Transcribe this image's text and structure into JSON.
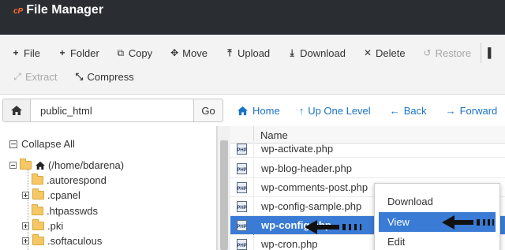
{
  "app": {
    "logo": "cP",
    "title": "File Manager"
  },
  "toolbar": {
    "row1": [
      {
        "label": "File",
        "icon": "plus-icon",
        "glyph": "+",
        "disabled": false
      },
      {
        "label": "Folder",
        "icon": "plus-icon",
        "glyph": "+",
        "disabled": false
      },
      {
        "label": "Copy",
        "icon": "copy-icon",
        "glyph": "⧉",
        "disabled": false
      },
      {
        "label": "Move",
        "icon": "move-icon",
        "glyph": "✥",
        "disabled": false
      },
      {
        "label": "Upload",
        "icon": "upload-icon",
        "glyph": "⤒",
        "disabled": false
      },
      {
        "label": "Download",
        "icon": "download-icon",
        "glyph": "⤓",
        "disabled": false
      },
      {
        "label": "Delete",
        "icon": "close-icon",
        "glyph": "✕",
        "disabled": false
      },
      {
        "label": "Restore",
        "icon": "undo-icon",
        "glyph": "↺",
        "disabled": true
      }
    ],
    "row2": [
      {
        "label": "Extract",
        "icon": "extract-icon",
        "glyph": "⤢",
        "disabled": true
      },
      {
        "label": "Compress",
        "icon": "compress-icon",
        "glyph": "⤡",
        "disabled": false
      }
    ]
  },
  "pathbar": {
    "value": "public_html",
    "go_label": "Go"
  },
  "nav": [
    {
      "label": "Home",
      "icon": "home-icon",
      "glyph": "⌂"
    },
    {
      "label": "Up One Level",
      "icon": "level-up-icon",
      "glyph": "↑"
    },
    {
      "label": "Back",
      "icon": "arrow-left-icon",
      "glyph": "←"
    },
    {
      "label": "Forward",
      "icon": "arrow-right-icon",
      "glyph": "→"
    }
  ],
  "tree": {
    "collapse_label": "Collapse All",
    "root_label": "(/home/bdarena)",
    "items": [
      {
        "label": ".autorespond",
        "expandable": false
      },
      {
        "label": ".cpanel",
        "expandable": true
      },
      {
        "label": ".htpasswds",
        "expandable": false
      },
      {
        "label": ".pki",
        "expandable": true
      },
      {
        "label": ".softaculous",
        "expandable": true
      }
    ]
  },
  "filelist": {
    "column_name": "Name",
    "file_icon_text": "PHP",
    "files": [
      {
        "name": "wp-activate.php",
        "selected": false
      },
      {
        "name": "wp-blog-header.php",
        "selected": false
      },
      {
        "name": "wp-comments-post.php",
        "selected": false
      },
      {
        "name": "wp-config-sample.php",
        "selected": false
      },
      {
        "name": "wp-config.php",
        "selected": true
      },
      {
        "name": "wp-cron.php",
        "selected": false
      }
    ]
  },
  "context_menu": {
    "items": [
      {
        "label": "Download",
        "active": false
      },
      {
        "label": "View",
        "active": true
      },
      {
        "label": "Edit",
        "active": false
      }
    ]
  },
  "colors": {
    "header_bg": "#2a2e33",
    "brand_accent": "#ff6c2c",
    "link": "#1b72c6",
    "selection": "#3a7bd5"
  }
}
